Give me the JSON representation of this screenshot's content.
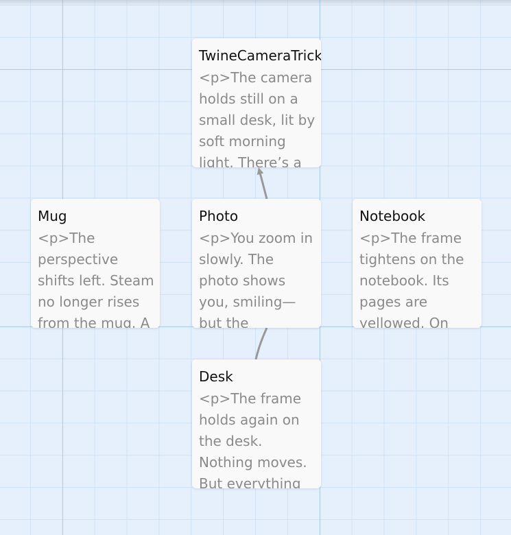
{
  "passages": [
    {
      "name": "TwineCameraTrick",
      "excerpt": "<p>The camera holds still on a small desk, lit by soft morning light. There’s a"
    },
    {
      "name": "Mug",
      "excerpt": "<p>The perspective shifts left. Steam no longer rises from the mug. A"
    },
    {
      "name": "Photo",
      "excerpt": "<p>You zoom in slowly. The photo shows you, smiling—but the"
    },
    {
      "name": "Notebook",
      "excerpt": "<p>The frame tightens on the notebook. Its pages are yellowed. On"
    },
    {
      "name": "Desk",
      "excerpt": "<p>The frame holds again on the desk. Nothing moves. But everything"
    }
  ],
  "colors": {
    "canvas": "#e6f0fc",
    "grid_major": "#a8cdf0",
    "grid_minor": "#cde2f7",
    "card": "#f9f9f9",
    "connection": "#999999"
  }
}
